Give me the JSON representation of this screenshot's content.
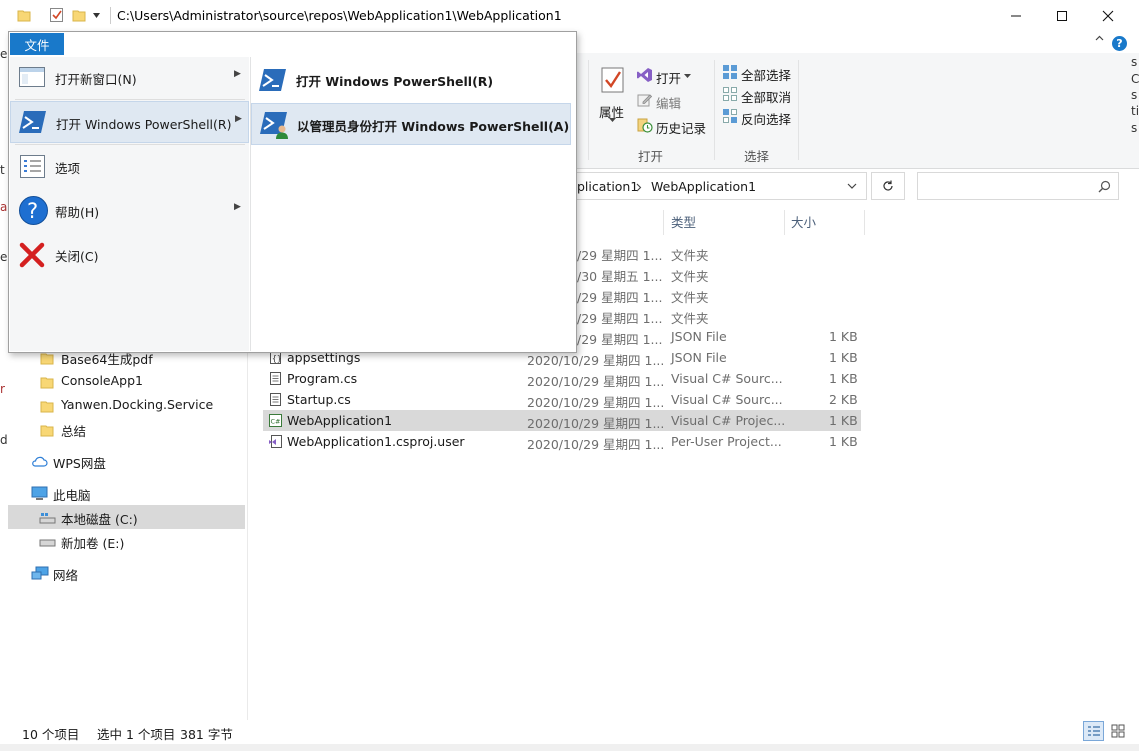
{
  "window": {
    "path": "C:\\Users\\Administrator\\source\\repos\\WebApplication1\\WebApplication1"
  },
  "ribbon": {
    "properties_label": "属性",
    "open_label": "打开",
    "edit_label": "编辑",
    "history_label": "历史记录",
    "group_open_label": "打开",
    "select_all_label": "全部选择",
    "select_none_label": "全部取消",
    "invert_select_label": "反向选择",
    "group_select_label": "选择"
  },
  "address": {
    "partial_path": "plication1",
    "current_folder": "WebApplication1",
    "search_placeholder": ""
  },
  "file_menu": {
    "tab_label": "文件",
    "items": [
      {
        "label": "打开新窗口(N)",
        "icon": "new-window-icon",
        "has_submenu": true
      },
      {
        "label": "打开 Windows PowerShell(R)",
        "icon": "powershell-icon",
        "has_submenu": true
      },
      {
        "label": "选项",
        "icon": "options-icon",
        "has_submenu": false
      },
      {
        "label": "帮助(H)",
        "icon": "help-icon",
        "has_submenu": true
      },
      {
        "label": "关闭(C)",
        "icon": "close-icon",
        "has_submenu": false
      }
    ],
    "submenu": [
      {
        "label": "打开 Windows PowerShell(R)",
        "icon": "powershell-icon"
      },
      {
        "label": "以管理员身份打开 Windows PowerShell(A)",
        "icon": "powershell-admin-icon"
      }
    ]
  },
  "columns": {
    "type": "类型",
    "size": "大小"
  },
  "files": [
    {
      "name": "",
      "date": "/29 星期四 1...",
      "type": "文件夹",
      "size": "",
      "icon": ""
    },
    {
      "name": "",
      "date": "/30 星期五 1...",
      "type": "文件夹",
      "size": "",
      "icon": ""
    },
    {
      "name": "",
      "date": "/29 星期四 1...",
      "type": "文件夹",
      "size": "",
      "icon": ""
    },
    {
      "name": "",
      "date": "/29 星期四 1...",
      "type": "文件夹",
      "size": "",
      "icon": ""
    },
    {
      "name": "",
      "date": "/29 星期四 1...",
      "type": "JSON File",
      "size": "1 KB",
      "icon": ""
    },
    {
      "name": "appsettings",
      "date": "2020/10/29 星期四 1...",
      "type": "JSON File",
      "size": "1 KB",
      "icon": "json-file-icon"
    },
    {
      "name": "Program.cs",
      "date": "2020/10/29 星期四 1...",
      "type": "Visual C# Sourc...",
      "size": "1 KB",
      "icon": "cs-file-icon"
    },
    {
      "name": "Startup.cs",
      "date": "2020/10/29 星期四 1...",
      "type": "Visual C# Sourc...",
      "size": "2 KB",
      "icon": "cs-file-icon"
    },
    {
      "name": "WebApplication1",
      "date": "2020/10/29 星期四 1...",
      "type": "Visual C# Projec...",
      "size": "1 KB",
      "icon": "csproj-icon"
    },
    {
      "name": "WebApplication1.csproj.user",
      "date": "2020/10/29 星期四 1...",
      "type": "Per-User Project...",
      "size": "1 KB",
      "icon": "vs-user-file-icon"
    }
  ],
  "navigation": {
    "folders": [
      "Base64生成pdf",
      "ConsoleApp1",
      "Yanwen.Docking.Service",
      "总结"
    ],
    "wps_cloud": "WPS网盘",
    "this_pc": "此电脑",
    "drive_c": "本地磁盘 (C:)",
    "drive_e": "新加卷 (E:)",
    "network": "网络"
  },
  "status": {
    "item_count": "10 个项目",
    "selection": "选中 1 个项目",
    "selection_size": "381 字节"
  },
  "edge_text": {
    "left": [
      "e",
      "t",
      "a",
      "e",
      "r",
      "d"
    ],
    "right": [
      "s",
      "C",
      "s",
      "ti",
      "s"
    ]
  },
  "colors": {
    "accent": "#1979ca",
    "selection": "#d9d9d9",
    "menu_hover": "#dfe8f2"
  }
}
